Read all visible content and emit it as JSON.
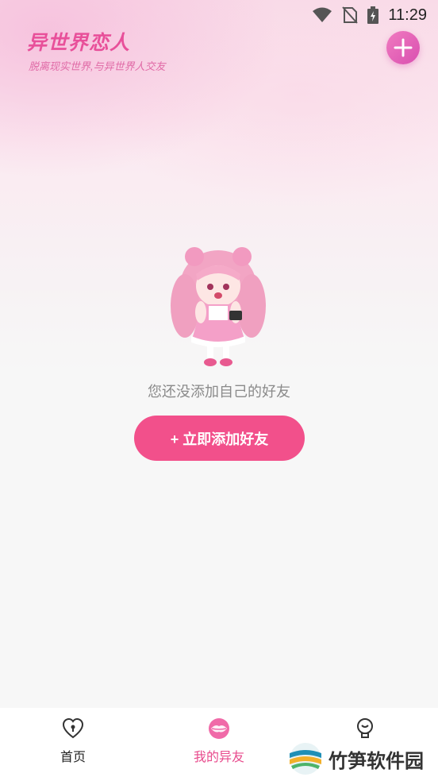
{
  "status_bar": {
    "time": "11:29"
  },
  "header": {
    "title": "异世界恋人",
    "subtitle": "脱离现实世界,与异世界人交友"
  },
  "empty_state": {
    "message": "您还没添加自己的好友",
    "cta_label": "+ 立即添加好友"
  },
  "bottom_nav": {
    "items": [
      {
        "label": "首页",
        "icon": "heart-lock-icon",
        "active": false
      },
      {
        "label": "我的异友",
        "icon": "lips-icon",
        "active": true
      },
      {
        "label": "",
        "icon": "bulb-icon",
        "active": false
      }
    ]
  },
  "watermark": {
    "text": "竹笋软件园"
  },
  "colors": {
    "accent": "#f2508b",
    "title": "#e8509a",
    "fab": "#d94fb0"
  }
}
